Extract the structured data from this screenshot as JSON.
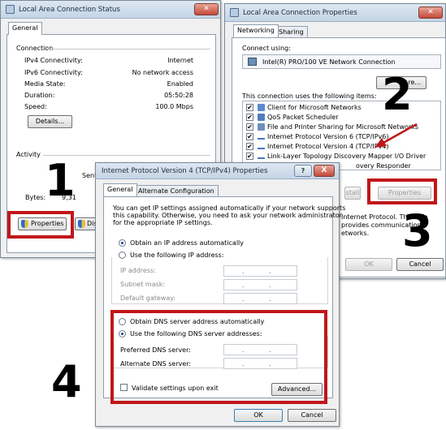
{
  "status_window": {
    "title": "Local Area Connection Status",
    "tab_general": "General",
    "section_connection": "Connection",
    "rows": [
      {
        "label": "IPv4 Connectivity:",
        "value": "Internet"
      },
      {
        "label": "IPv6 Connectivity:",
        "value": "No network access"
      },
      {
        "label": "Media State:",
        "value": "Enabled"
      },
      {
        "label": "Duration:",
        "value": "05:50:28"
      },
      {
        "label": "Speed:",
        "value": "100.0 Mbps"
      }
    ],
    "details_button": "Details...",
    "section_activity": "Activity",
    "sent_label": "Sent",
    "bytes_label": "Bytes:",
    "bytes_value": "9,31",
    "properties_button": "Properties",
    "disable_button": "Disa"
  },
  "props_window": {
    "title": "Local Area Connection Properties",
    "tab_networking": "Networking",
    "tab_sharing": "Sharing",
    "connect_using_label": "Connect using:",
    "adapter_name": "Intel(R) PRO/100 VE Network Connection",
    "configure_button": "re...",
    "items_label": "This connection uses the following items:",
    "items": [
      {
        "text": "Client for Microsoft Networks",
        "checked": "✔"
      },
      {
        "text": "QoS Packet Scheduler",
        "checked": "✔"
      },
      {
        "text": "File and Printer Sharing for Microsoft Networks",
        "checked": "✔"
      },
      {
        "text": "Internet Protocol Version 6 (TCP/IPv6)",
        "checked": "✔"
      },
      {
        "text": "Internet Protocol Version 4 (TCP/IPv4)",
        "checked": "✔"
      },
      {
        "text": "Link-Layer Topology Discovery Mapper I/O Driver",
        "checked": "✔"
      },
      {
        "text": "overy Responder",
        "checked": ""
      }
    ],
    "install_button": "stall",
    "properties_button": "Properties",
    "description_lines": [
      "Internet Protocol. The defa",
      "provides communication",
      "etworks."
    ],
    "ok_button": "OK",
    "cancel_button": "Cancel"
  },
  "ipv4_window": {
    "title": "Internet Protocol Version 4 (TCP/IPv4) Properties",
    "help_glyph": "?",
    "close_glyph": "X",
    "tab_general": "General",
    "tab_alternate": "Alternate Configuration",
    "intro_lines": [
      "You can get IP settings assigned automatically if your network supports",
      "this capability. Otherwise, you need to ask your network administrator",
      "for the appropriate IP settings."
    ],
    "radio_auto_ip": "Obtain an IP address automatically",
    "radio_manual_ip": "Use the following IP address:",
    "ip_address_label": "IP address:",
    "subnet_mask_label": "Subnet mask:",
    "default_gateway_label": "Default gateway:",
    "radio_auto_dns": "Obtain DNS server address automatically",
    "radio_manual_dns": "Use the following DNS server addresses:",
    "preferred_dns_label": "Preferred DNS server:",
    "alternate_dns_label": "Alternate DNS server:",
    "validate_label": "Validate settings upon exit",
    "advanced_button": "Advanced...",
    "ok_button": "OK",
    "cancel_button": "Cancel",
    "ip_dots": ". . ."
  },
  "annotations": {
    "step1": "1",
    "step2": "2",
    "step3": "3",
    "step4": "4",
    "highlight_color": "#c0171a"
  }
}
